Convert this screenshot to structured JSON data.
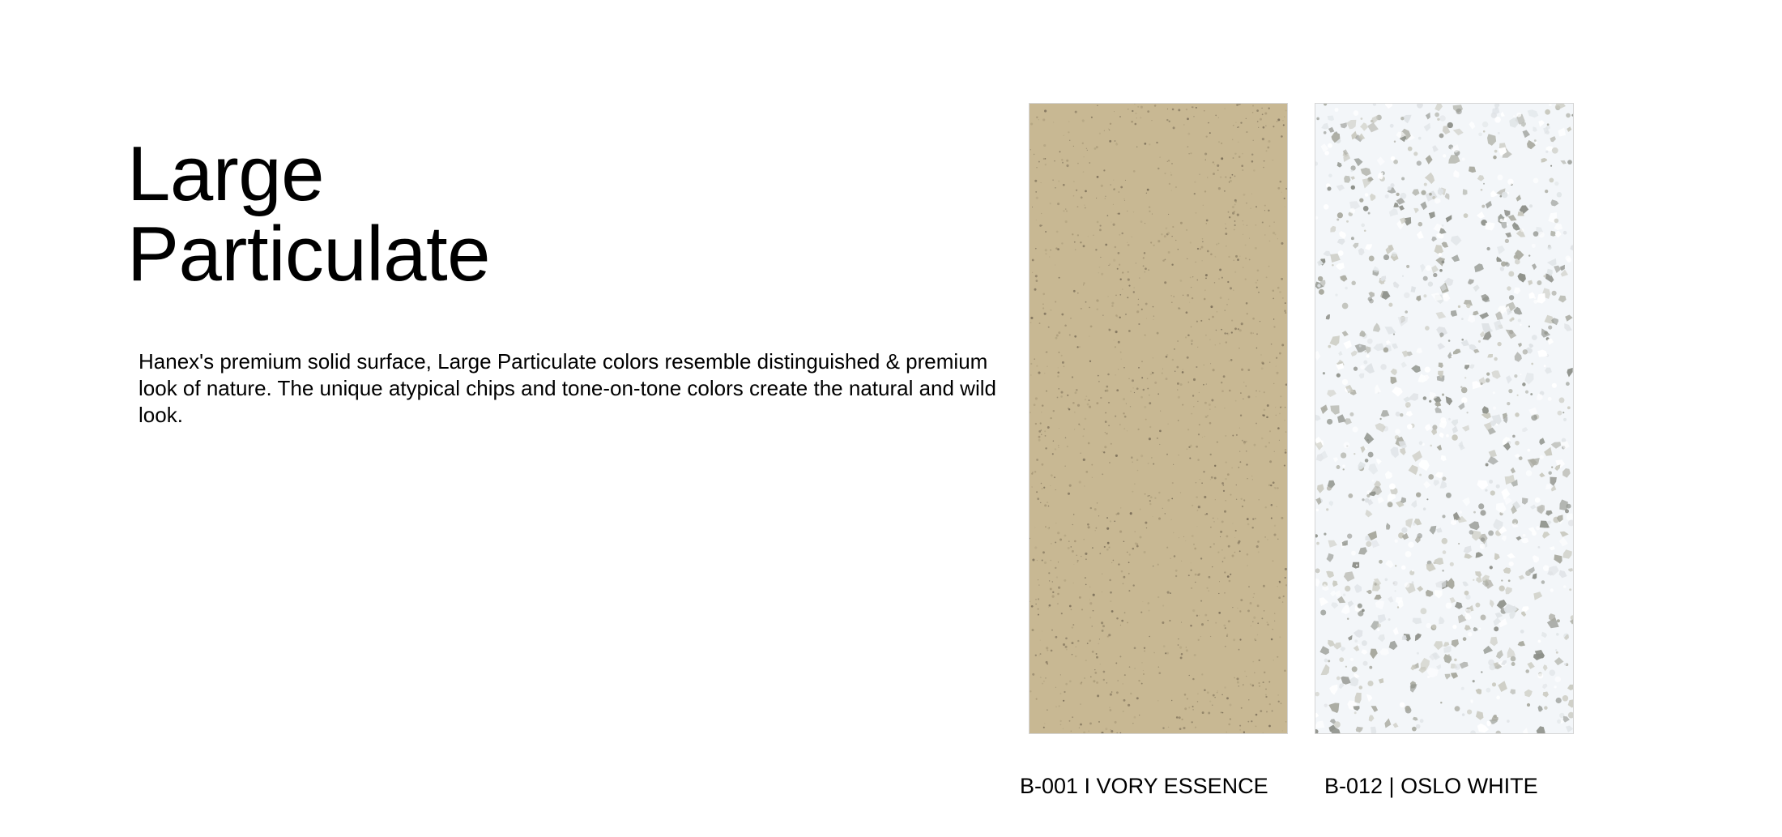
{
  "title": {
    "line1": "Large",
    "line2": "Particulate"
  },
  "description": "Hanex's premium solid surface, Large Particulate colors resemble distinguished & premium look of nature. The unique atypical chips and tone-on-tone colors create the natural and wild look.",
  "swatches": [
    {
      "label": "B-001 I VORY ESSENCE",
      "base_color": "#c8b893",
      "speck_colors": [
        "#8f8166",
        "#a89877",
        "#b5a683",
        "#7d705a"
      ]
    },
    {
      "label": "B-012 | OSLO WHITE",
      "base_color": "#f3f6f9",
      "speck_colors": [
        "#c9c9bf",
        "#a9aaa0",
        "#dfe3e6",
        "#8e918a",
        "#ffffff"
      ]
    }
  ]
}
